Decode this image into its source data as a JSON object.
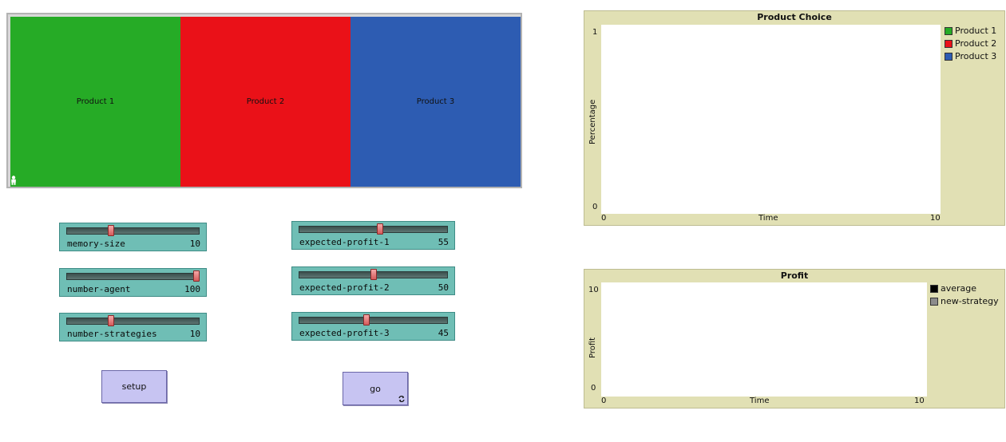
{
  "world": {
    "patches": [
      {
        "label": "Product 1",
        "color": "#26ab26"
      },
      {
        "label": "Product 2",
        "color": "#ea1118"
      },
      {
        "label": "Product 3",
        "color": "#2d5cb2"
      }
    ]
  },
  "sliders": {
    "memory_size": {
      "label": "memory-size",
      "value": "10",
      "fraction": 0.33
    },
    "number_agent": {
      "label": "number-agent",
      "value": "100",
      "fraction": 1.0
    },
    "number_strategies": {
      "label": "number-strategies",
      "value": "10",
      "fraction": 0.33
    },
    "expected_profit_1": {
      "label": "expected-profit-1",
      "value": "55",
      "fraction": 0.55
    },
    "expected_profit_2": {
      "label": "expected-profit-2",
      "value": "50",
      "fraction": 0.5
    },
    "expected_profit_3": {
      "label": "expected-profit-3",
      "value": "45",
      "fraction": 0.45
    }
  },
  "buttons": {
    "setup": "setup",
    "go": "go",
    "go_forever_icon": "forever-arrows-icon"
  },
  "plots": {
    "product_choice": {
      "title": "Product Choice",
      "xlabel": "Time",
      "ylabel": "Percentage",
      "xmin": "0",
      "xmax": "10",
      "ymin": "0",
      "ymax": "1",
      "legend": [
        {
          "name": "Product 1",
          "color": "#26ab26"
        },
        {
          "name": "Product 2",
          "color": "#ea1118"
        },
        {
          "name": "Product 3",
          "color": "#2d5cb2"
        }
      ]
    },
    "profit": {
      "title": "Profit",
      "xlabel": "Time",
      "ylabel": "Profit",
      "xmin": "0",
      "xmax": "10",
      "ymin": "0",
      "ymax": "10",
      "legend": [
        {
          "name": "average",
          "color": "#000000"
        },
        {
          "name": "new-strategy",
          "color": "#8c8c8c"
        }
      ]
    }
  }
}
